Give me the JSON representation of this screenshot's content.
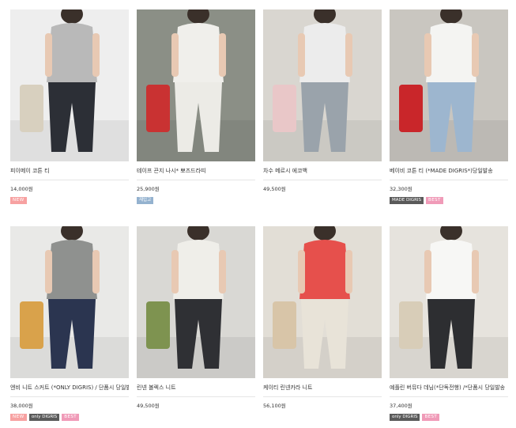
{
  "products": [
    {
      "name": "피이메이 코튼 티",
      "price": "14,000원",
      "badges": [
        {
          "label": "NEW",
          "type": "new"
        }
      ]
    },
    {
      "name": "테이프 끈지 나시* 뽀즈드라띠",
      "price": "25,900원",
      "badges": [
        {
          "label": "재입고",
          "type": "restock"
        }
      ]
    },
    {
      "name": "차수 메르시 에코백",
      "price": "49,500원",
      "badges": []
    },
    {
      "name": "베이비 코튼 티 (*MADE DIGRIS*)당일발송",
      "price": "32,300원",
      "badges": [
        {
          "label": "MADE DIGRIS",
          "type": "dark"
        },
        {
          "label": "BEST",
          "type": "best"
        }
      ]
    },
    {
      "name": "엔비 니트 스커트 (*ONLY DIGRIS) / 단품시 당일발송",
      "price": "38,000원",
      "badges": [
        {
          "label": "NEW",
          "type": "new"
        },
        {
          "label": "only DIGRIS",
          "type": "dark"
        },
        {
          "label": "BEST",
          "type": "best"
        }
      ]
    },
    {
      "name": "린넨 볼렉스 니트",
      "price": "49,500원",
      "badges": []
    },
    {
      "name": "케이티 린넨카라 니트",
      "price": "56,100원",
      "badges": []
    },
    {
      "name": "예플린 버뮤다 데님(*단독전행) /*단품시 당일발송",
      "price": "37,400원",
      "badges": [
        {
          "label": "only DIGRIS",
          "type": "dark"
        },
        {
          "label": "BEST",
          "type": "best"
        }
      ]
    }
  ],
  "photo_colors": [
    {
      "bg": "#eeeeee",
      "top": "#b9b9b9",
      "bottom": "#2c2f36",
      "accent": "#d8d0bf"
    },
    {
      "bg": "#8b8f86",
      "top": "#f0efeb",
      "bottom": "#ecebe6",
      "accent": "#c93232"
    },
    {
      "bg": "#d9d6d0",
      "top": "#ececec",
      "bottom": "#9aa3ab",
      "accent": "#e9c7c8"
    },
    {
      "bg": "#c9c6c0",
      "top": "#f4f4f2",
      "bottom": "#9db6cf",
      "accent": "#c9262a"
    },
    {
      "bg": "#e9e9e7",
      "top": "#8f918f",
      "bottom": "#2b3550",
      "accent": "#d9a24b"
    },
    {
      "bg": "#d9d8d4",
      "top": "#efeee9",
      "bottom": "#2f3034",
      "accent": "#7e9350"
    },
    {
      "bg": "#e2ded6",
      "top": "#e6504c",
      "bottom": "#e8e3d8",
      "accent": "#d8c5a8"
    },
    {
      "bg": "#e6e3dd",
      "top": "#f7f7f5",
      "bottom": "#2d2e31",
      "accent": "#d8cdb8"
    }
  ]
}
